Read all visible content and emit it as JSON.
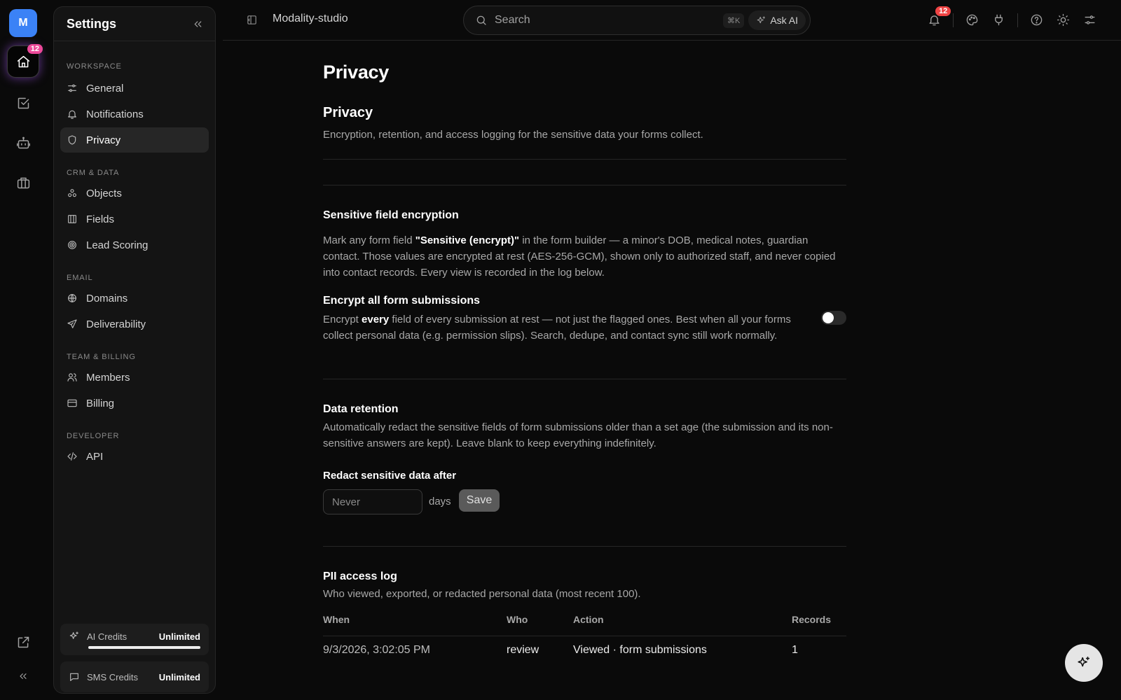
{
  "rail": {
    "avatar_letter": "M",
    "home_badge": "12",
    "items": [
      "home-icon",
      "checklist-icon",
      "bot-icon",
      "briefcase-icon"
    ],
    "bottom": [
      "external-link-icon",
      "double-chevron-left-icon"
    ]
  },
  "sidebar": {
    "title": "Settings",
    "sections": {
      "workspace": "WORKSPACE",
      "crm": "CRM & DATA",
      "email": "EMAIL",
      "team": "TEAM & BILLING",
      "developer": "DEVELOPER"
    },
    "items": {
      "general": "General",
      "notifications": "Notifications",
      "privacy": "Privacy",
      "objects": "Objects",
      "fields": "Fields",
      "lead_scoring": "Lead Scoring",
      "domains": "Domains",
      "deliverability": "Deliverability",
      "members": "Members",
      "billing": "Billing",
      "api": "API"
    },
    "active_item": "privacy",
    "credits": {
      "ai_label": "AI Credits",
      "ai_value": "Unlimited",
      "ai_fill": 1.0,
      "sms_label": "SMS Credits",
      "sms_value": "Unlimited"
    }
  },
  "topbar": {
    "workspace": "Modality-studio",
    "search_placeholder": "Search",
    "shortcut": "⌘K",
    "ask_ai": "Ask AI",
    "notifications_badge": "12"
  },
  "page": {
    "title": "Privacy",
    "subtitle": "Privacy",
    "lead": "Encryption, retention, and access logging for the sensitive data your forms collect.",
    "encryption": {
      "title": "Sensitive field encryption",
      "p_before": "Mark any form field ",
      "p_strong": "\"Sensitive (encrypt)\"",
      "p_after": " in the form builder — a minor's DOB, medical notes, guardian contact. Those values are encrypted at rest (AES-256-GCM), shown only to authorized staff, and never copied into contact records. Every view is recorded in the log below.",
      "all_title": "Encrypt all form submissions",
      "all_before": "Encrypt ",
      "all_strong": "every",
      "all_after": " field of every submission at rest — not just the flagged ones. Best when all your forms collect personal data (e.g. permission slips). Search, dedupe, and contact sync still work normally.",
      "toggle_on": false
    },
    "retention": {
      "title": "Data retention",
      "desc": "Automatically redact the sensitive fields of form submissions older than a set age (the submission and its non-sensitive answers are kept). Leave blank to keep everything indefinitely.",
      "label": "Redact sensitive data after",
      "placeholder": "Never",
      "value": "",
      "unit": "days",
      "save": "Save"
    },
    "log": {
      "title": "PII access log",
      "desc": "Who viewed, exported, or redacted personal data (most recent 100).",
      "columns": [
        "When",
        "Who",
        "Action",
        "Records"
      ],
      "rows": [
        [
          "9/3/2026, 3:02:05 PM",
          "review",
          "Viewed · form submissions",
          "1"
        ]
      ]
    }
  }
}
